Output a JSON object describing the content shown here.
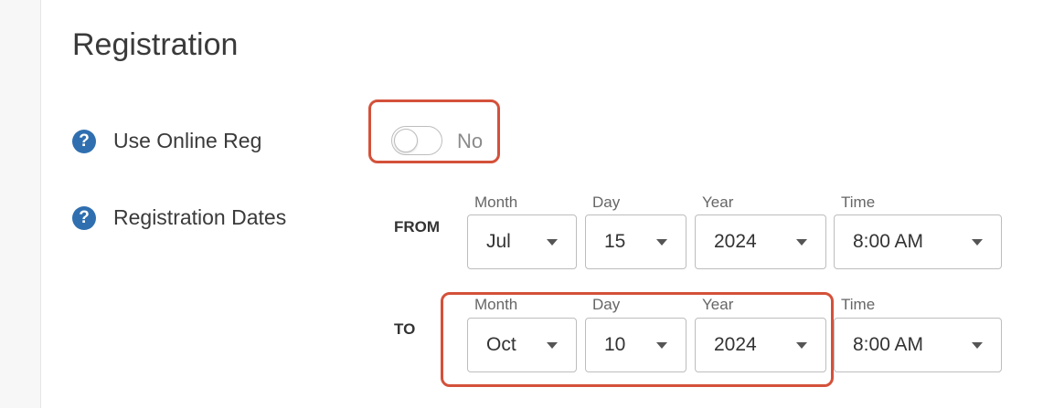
{
  "section": {
    "title": "Registration"
  },
  "online_reg": {
    "label": "Use Online Reg",
    "toggle_state": false,
    "toggle_text": "No"
  },
  "reg_dates": {
    "label": "Registration Dates",
    "field_labels": {
      "month": "Month",
      "day": "Day",
      "year": "Year",
      "time": "Time"
    },
    "from": {
      "label": "FROM",
      "month": "Jul",
      "day": "15",
      "year": "2024",
      "time": "8:00 AM"
    },
    "to": {
      "label": "TO",
      "month": "Oct",
      "day": "10",
      "year": "2024",
      "time": "8:00 AM"
    }
  },
  "help_icon": {
    "glyph": "?"
  },
  "colors": {
    "highlight": "#d4513a",
    "help_icon": "#2f6fb0"
  }
}
